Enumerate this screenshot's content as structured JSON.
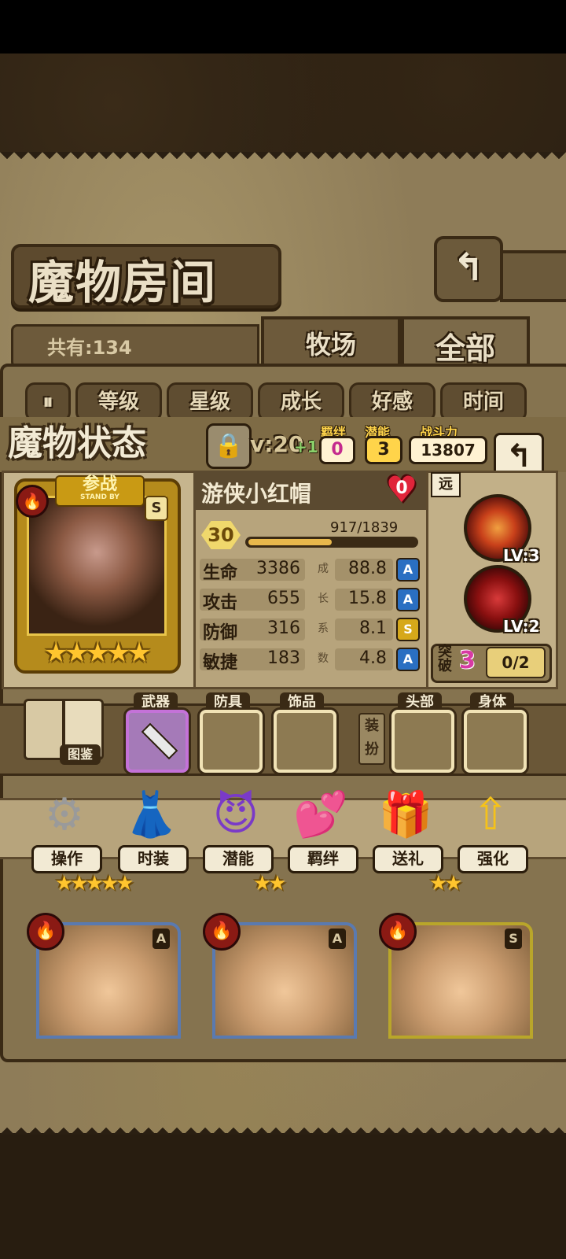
{
  "header": {
    "title": "魔物房间",
    "back_icon": "↰"
  },
  "collection": {
    "count_label": "共有:134"
  },
  "tabs": [
    {
      "label": "牧场"
    },
    {
      "label": "全部"
    }
  ],
  "sort": {
    "toggle_icon": "⏸",
    "buttons": [
      {
        "label": "等级"
      },
      {
        "label": "星级"
      },
      {
        "label": "成长"
      },
      {
        "label": "好感"
      },
      {
        "label": "时间"
      }
    ]
  },
  "status": {
    "title": "魔物状态",
    "lock_icon": "🔒",
    "level_text": "v:20",
    "level_plus": "+1",
    "bond": {
      "label": "羁绊",
      "value": "0"
    },
    "potential": {
      "label": "潜能",
      "value": "3"
    },
    "power": {
      "label": "战斗力",
      "value": "13807"
    },
    "back_icon": "↰"
  },
  "monster": {
    "card_badge_title": "参战",
    "card_badge_sub": "STAND BY",
    "rank": "S",
    "stars": "★★★★★",
    "element_icon": "🔥",
    "name": "游侠小红帽",
    "affection": "0",
    "level": "30",
    "exp_text": "917/1839",
    "exp_fraction": 0.499,
    "stats": [
      {
        "label": "生命",
        "value": "3386",
        "growth": "88.8",
        "grade": "A",
        "grade_color": "#2a6fc2"
      },
      {
        "label": "攻击",
        "value": "655",
        "growth": "15.8",
        "grade": "A",
        "grade_color": "#2a6fc2"
      },
      {
        "label": "防御",
        "value": "316",
        "growth": "8.1",
        "grade": "S",
        "grade_color": "#d6a81a"
      },
      {
        "label": "敏捷",
        "value": "183",
        "growth": "4.8",
        "grade": "A",
        "grade_color": "#2a6fc2"
      }
    ],
    "growth_label_chars": [
      "成",
      "长",
      "系",
      "数"
    ],
    "range_tag": "远",
    "skills": [
      {
        "level": "LV:3"
      },
      {
        "level": "LV:2"
      }
    ],
    "breakthrough": {
      "label": "突破",
      "count": "3",
      "progress": "0/2"
    }
  },
  "equipment": {
    "book_label": "图鉴",
    "dress_side_label": "装扮",
    "slots": [
      {
        "label": "武器"
      },
      {
        "label": "防具"
      },
      {
        "label": "饰品"
      },
      {
        "label": "头部"
      },
      {
        "label": "身体"
      }
    ]
  },
  "actions": [
    {
      "label": "操作",
      "icon": "⚙"
    },
    {
      "label": "时装",
      "icon": "👗"
    },
    {
      "label": "潜能",
      "icon": "😈"
    },
    {
      "label": "羁绊",
      "icon": "💕"
    },
    {
      "label": "送礼",
      "icon": "🎁"
    },
    {
      "label": "强化",
      "icon": "⇧"
    }
  ],
  "grid_cards": [
    {
      "rank": "A",
      "element_icon": "🔥"
    },
    {
      "rank": "A",
      "element_icon": "🔥"
    },
    {
      "rank": "S",
      "element_icon": "🔥"
    }
  ],
  "grid_stars": [
    "★★★★★",
    "★★",
    "★★"
  ],
  "colors": {
    "accent_gold": "#ffc52e",
    "panel": "#b7a47c",
    "dark_brown": "#2b1d0c"
  }
}
